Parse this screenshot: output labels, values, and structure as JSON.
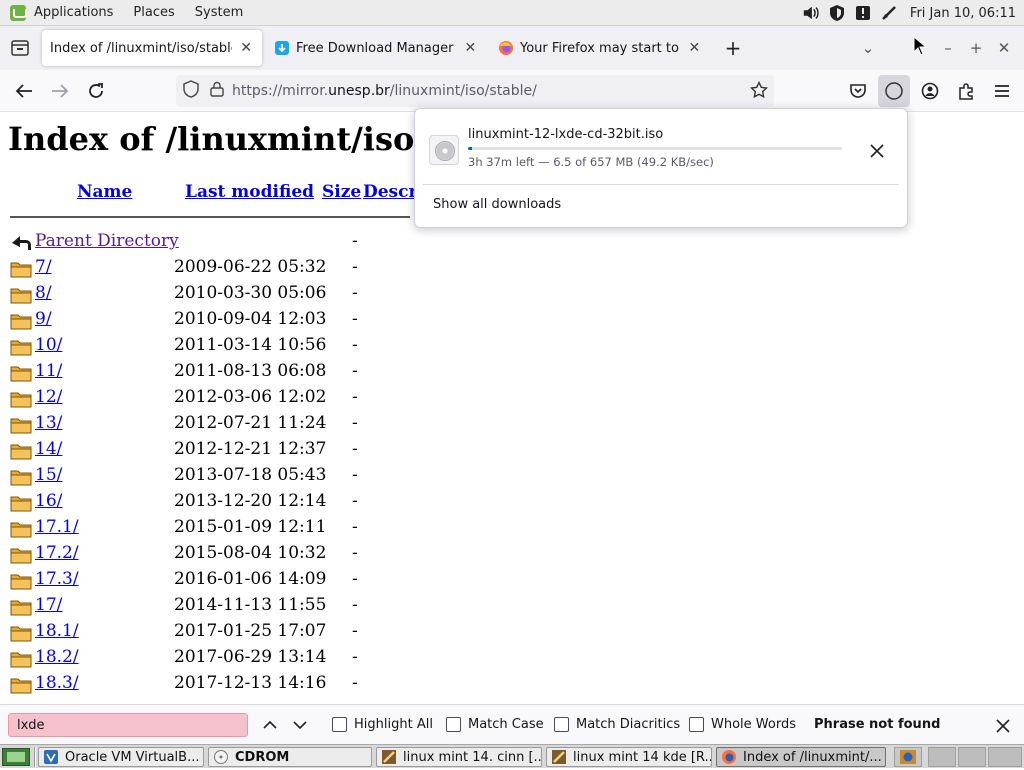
{
  "system_panel": {
    "menus": [
      "Applications",
      "Places",
      "System"
    ],
    "clock": "Fri Jan 10, 06:11"
  },
  "tabs": [
    {
      "label": "Index of /linuxmint/iso/stable",
      "active": true
    },
    {
      "label": "Free Download Manager for",
      "active": false
    },
    {
      "label": "Your Firefox may start to ha",
      "active": false
    }
  ],
  "urlbar": {
    "prefix": "https://mirror.",
    "domain": "unesp.br",
    "path": "/linuxmint/iso/stable/"
  },
  "page": {
    "title": "Index of /linuxmint/iso/stable",
    "columns": {
      "name": "Name",
      "last_modified": "Last modified",
      "size": "Size",
      "description": "Description"
    },
    "parent": {
      "name": "Parent Directory",
      "size": "-"
    },
    "rows": [
      {
        "name": "7/",
        "date": "2009-06-22 05:32",
        "size": "-"
      },
      {
        "name": "8/",
        "date": "2010-03-30 05:06",
        "size": "-"
      },
      {
        "name": "9/",
        "date": "2010-09-04 12:03",
        "size": "-"
      },
      {
        "name": "10/",
        "date": "2011-03-14 10:56",
        "size": "-"
      },
      {
        "name": "11/",
        "date": "2011-08-13 06:08",
        "size": "-"
      },
      {
        "name": "12/",
        "date": "2012-03-06 12:02",
        "size": "-"
      },
      {
        "name": "13/",
        "date": "2012-07-21 11:24",
        "size": "-"
      },
      {
        "name": "14/",
        "date": "2012-12-21 12:37",
        "size": "-"
      },
      {
        "name": "15/",
        "date": "2013-07-18 05:43",
        "size": "-"
      },
      {
        "name": "16/",
        "date": "2013-12-20 12:14",
        "size": "-"
      },
      {
        "name": "17.1/",
        "date": "2015-01-09 12:11",
        "size": "-"
      },
      {
        "name": "17.2/",
        "date": "2015-08-04 10:32",
        "size": "-"
      },
      {
        "name": "17.3/",
        "date": "2016-01-06 14:09",
        "size": "-"
      },
      {
        "name": "17/",
        "date": "2014-11-13 11:55",
        "size": "-"
      },
      {
        "name": "18.1/",
        "date": "2017-01-25 17:07",
        "size": "-"
      },
      {
        "name": "18.2/",
        "date": "2017-06-29 13:14",
        "size": "-"
      },
      {
        "name": "18.3/",
        "date": "2017-12-13 14:16",
        "size": "-"
      }
    ]
  },
  "downloads": {
    "filename": "linuxmint-12-lxde-cd-32bit.iso",
    "status": "3h 37m left — 6.5 of 657 MB (49.2 KB/sec)",
    "progress_fraction": 0.0099,
    "show_all": "Show all downloads"
  },
  "findbar": {
    "query": "lxde",
    "options": [
      "Highlight All",
      "Match Case",
      "Match Diacritics",
      "Whole Words"
    ],
    "result": "Phrase not found"
  },
  "taskbar": {
    "items": [
      {
        "label": "Oracle VM VirtualB...",
        "icon": "virtualbox-icon"
      },
      {
        "label": "CDROM",
        "icon": "cdrom-icon"
      },
      {
        "label": "linux mint 14. cinn [...",
        "icon": "app-icon"
      },
      {
        "label": "linux mint 14 kde [R...",
        "icon": "app-icon"
      },
      {
        "label": "Index of /linuxmint/...",
        "icon": "firefox-icon"
      }
    ]
  },
  "colors": {
    "link": "#0000ee",
    "visited": "#551a8b",
    "find_not_found": "#f5c1cd",
    "progress": "#0061e0"
  }
}
